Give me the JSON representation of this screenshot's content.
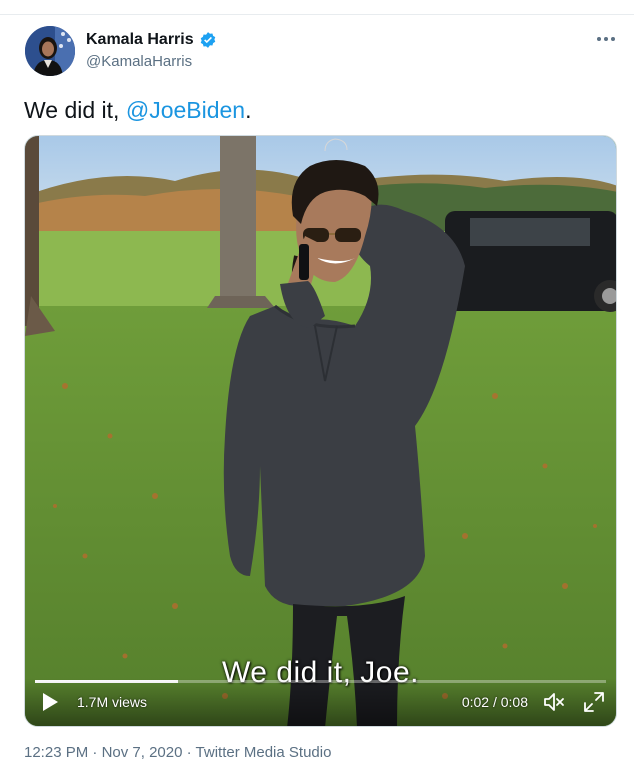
{
  "user": {
    "display_name": "Kamala Harris",
    "handle": "@KamalaHarris",
    "verified": true,
    "avatar_icon": "profile-photo"
  },
  "more_icon": "ellipsis-icon",
  "tweet": {
    "text_prefix": "We did it, ",
    "mention": "@JoeBiden",
    "text_suffix": "."
  },
  "video": {
    "caption": "We did it, Joe.",
    "views": "1.7M views",
    "time": "0:02 / 0:08",
    "progress_fraction": 0.25,
    "icons": [
      "play-icon",
      "mute-icon",
      "fullscreen-icon"
    ]
  },
  "meta": {
    "time": "12:23 PM",
    "separator": "·",
    "date": "Nov 7, 2020",
    "source": "Twitter Media Studio"
  },
  "colors": {
    "mention": "#1b95e0",
    "verified": "#1da1f2",
    "secondary_text": "#5b7083"
  }
}
